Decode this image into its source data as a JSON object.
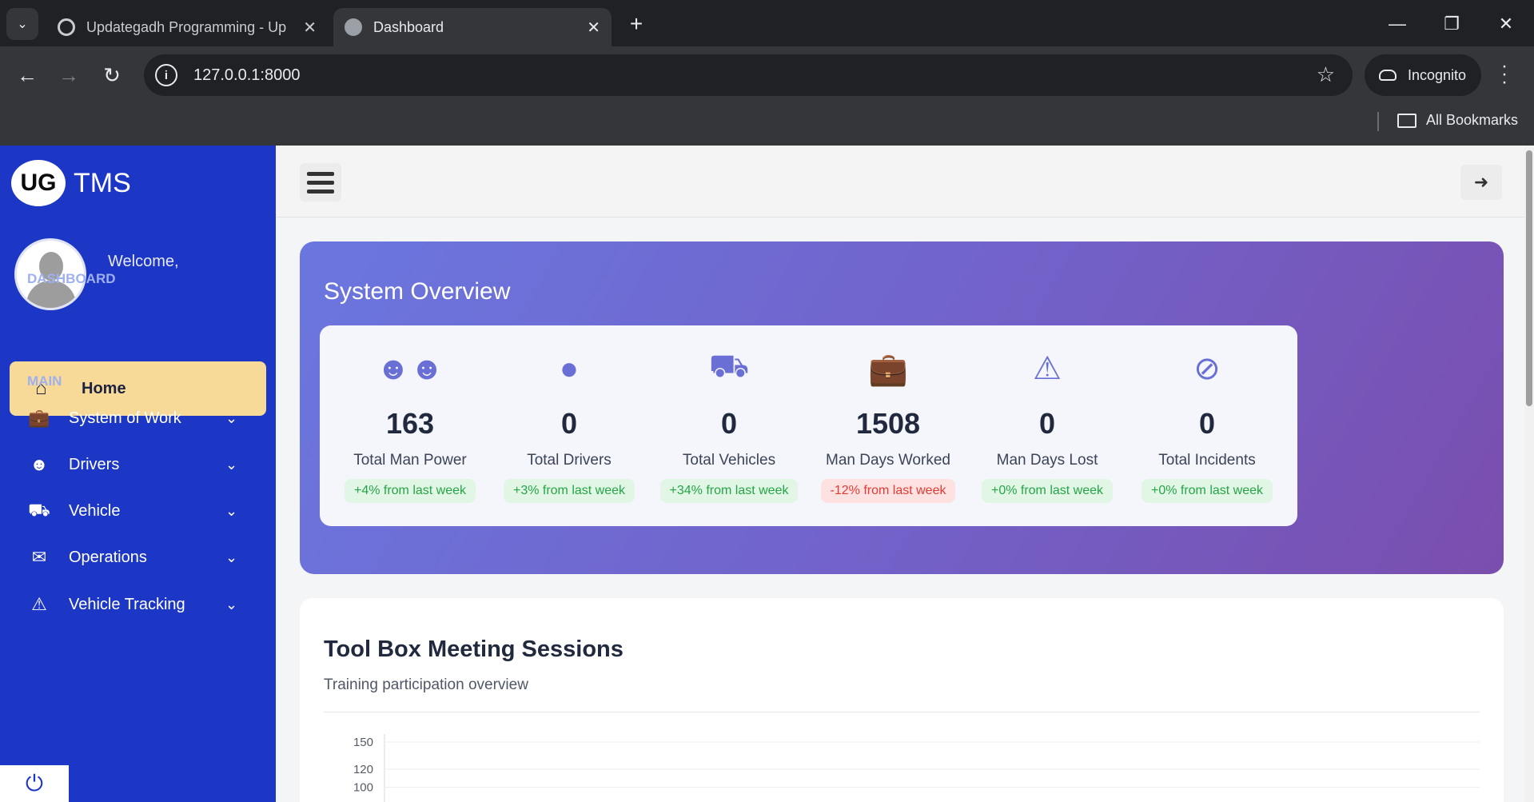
{
  "browser": {
    "tabs": [
      {
        "title": "Updategadh Programming - Up",
        "active": false
      },
      {
        "title": "Dashboard",
        "active": true
      }
    ],
    "url": "127.0.0.1:8000",
    "profile": "Incognito",
    "bookmarks_label": "All Bookmarks"
  },
  "sidebar": {
    "brand_logo": "UG",
    "brand_name": "TMS",
    "welcome": "Welcome,",
    "dashboard_section": "DASHBOARD",
    "home_label": "Home",
    "main_section": "MAIN",
    "items": [
      {
        "label": "System of Work",
        "icon": "briefcase-icon"
      },
      {
        "label": "Drivers",
        "icon": "users-icon"
      },
      {
        "label": "Vehicle",
        "icon": "car-icon"
      },
      {
        "label": "Operations",
        "icon": "envelope-icon"
      },
      {
        "label": "Vehicle Tracking",
        "icon": "warning-icon"
      }
    ]
  },
  "overview": {
    "title": "System Overview",
    "stats": [
      {
        "value": "163",
        "label": "Total Man Power",
        "change": "+4% from last week",
        "trend": "up",
        "icon": "users-icon"
      },
      {
        "value": "0",
        "label": "Total Drivers",
        "change": "+3% from last week",
        "trend": "up",
        "icon": "user-icon"
      },
      {
        "value": "0",
        "label": "Total Vehicles",
        "change": "+34% from last week",
        "trend": "up",
        "icon": "truck-icon"
      },
      {
        "value": "1508",
        "label": "Man Days Worked",
        "change": "-12% from last week",
        "trend": "down",
        "icon": "briefcase-icon"
      },
      {
        "value": "0",
        "label": "Man Days Lost",
        "change": "+0% from last week",
        "trend": "up",
        "icon": "warning-icon"
      },
      {
        "value": "0",
        "label": "Total Incidents",
        "change": "+0% from last week",
        "trend": "up",
        "icon": "ban-icon"
      }
    ]
  },
  "toolbox": {
    "title": "Tool Box Meeting Sessions",
    "subtitle": "Training participation overview"
  },
  "chart_data": {
    "type": "bar",
    "title": "",
    "xlabel": "",
    "ylabel": "",
    "y_ticks": [
      150,
      120,
      100
    ],
    "categories": [],
    "values": []
  },
  "colors": {
    "sidebar": "#1c37c6",
    "home_active": "#f8da98",
    "accent_icon": "#6a6fd6",
    "badge_up_text": "#25a547",
    "badge_down_text": "#e23b36"
  }
}
